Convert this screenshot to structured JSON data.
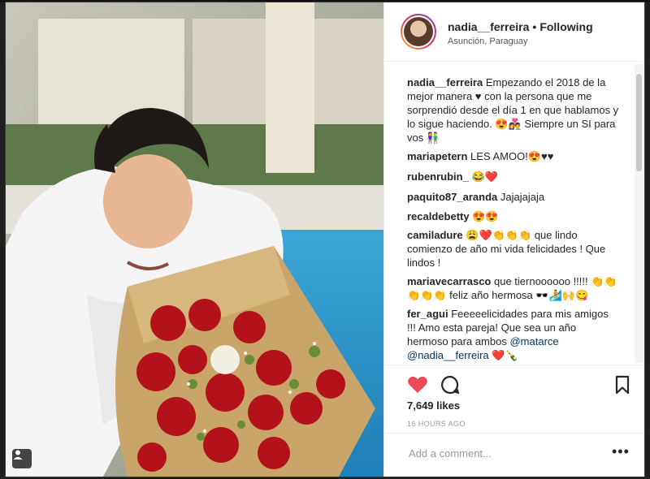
{
  "post": {
    "username": "nadia__ferreira",
    "follow_status": "Following",
    "dot": "•",
    "location": "Asunción, Paraguay"
  },
  "comments": [
    {
      "user": "nadia__ferreira",
      "text": "Empezando el 2018 de la mejor manera ♥ con la persona que me sorprendió desde el día 1 en que hablamos y lo sigue haciendo. 😍👩‍❤️‍👨 Siempre un SI para vos 👫"
    },
    {
      "user": "mariapetern",
      "text": "LES AMOO!😍♥♥"
    },
    {
      "user": "rubenrubin_",
      "text": "😂❤️"
    },
    {
      "user": "paquito87_aranda",
      "text": "Jajajajaja"
    },
    {
      "user": "recaldebetty",
      "text": "😍😍"
    },
    {
      "user": "camiladure",
      "text": "😩❤️👏👏👏 que lindo comienzo de año mi vida felicidades ! Que lindos !"
    },
    {
      "user": "mariavecarrasco",
      "text": "que tiernoooooo !!!!! 👏👏👏👏👏 feliz año hermosa 🕶️🏄🙌😋"
    },
    {
      "user": "fer_agui",
      "text": "Feeeeelicidades para mis amigos !!! Amo esta pareja! Que sea un año hermoso para ambos",
      "mentions": [
        "@matarce",
        "@nadia__ferreira"
      ],
      "tail": "❤️🍾"
    }
  ],
  "likes": "7,649 likes",
  "timestamp": "16 HOURS AGO",
  "add_comment": {
    "placeholder": "Add a comment..."
  },
  "more_label": "•••",
  "icons": {
    "like": "heart-filled-icon",
    "comment": "comment-icon",
    "save": "bookmark-icon",
    "photo_tag": "user-tag-icon"
  },
  "colors": {
    "like": "#ed4956",
    "text": "#262626",
    "muted": "#999999"
  }
}
